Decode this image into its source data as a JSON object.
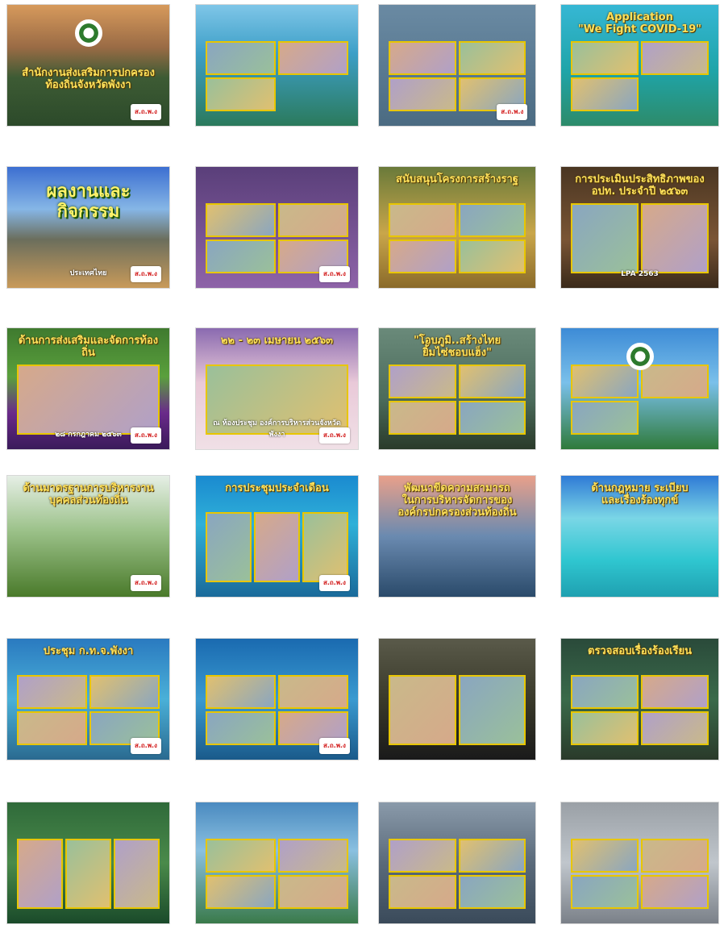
{
  "tiles": [
    {
      "caption": "สำนักงานส่งเสริมการปกครองท้องถิ่นจังหวัดพังงา",
      "sub": "",
      "bg": "linear-gradient(180deg,#d79a5c 0%,#9a6b45 35%,#3d5b34 60%,#2c4a2a 100%)",
      "style": "",
      "photos": 0,
      "cols": 1,
      "logo": "ส.ถ.พ.ง",
      "seal": true
    },
    {
      "caption": "",
      "sub": "",
      "bg": "linear-gradient(180deg,#7fc6e8 0%,#3d9fc7 40%,#2b7a5c 100%)",
      "style": "",
      "photos": 3,
      "cols": 2,
      "logo": "",
      "seal": false
    },
    {
      "caption": "",
      "sub": "",
      "bg": "linear-gradient(180deg,#6a8aa3 0%,#4b6b82 100%)",
      "style": "",
      "photos": 4,
      "cols": 2,
      "logo": "ส.ถ.พ.ง",
      "seal": false
    },
    {
      "caption": "Application\n\"We Fight COVID-19\"",
      "sub": "",
      "bg": "linear-gradient(180deg,#36b7d4 0%,#1fa4a8 55%,#2d8b6a 100%)",
      "style": "",
      "photos": 3,
      "cols": 2,
      "logo": "",
      "seal": false
    },
    {
      "caption": "ผลงานและกิจกรรม",
      "sub": "ประเทศไทย",
      "bg": "linear-gradient(180deg,#3c6fd1 0%,#86b6e6 35%,#6b6e5c 60%,#c89a5a 100%)",
      "style": "big",
      "photos": 0,
      "cols": 1,
      "logo": "ส.ถ.พ.ง",
      "seal": false
    },
    {
      "caption": "",
      "sub": "",
      "bg": "linear-gradient(180deg,#5a3f7a 0%,#8e63a8 100%)",
      "style": "",
      "photos": 4,
      "cols": 2,
      "logo": "ส.ถ.พ.ง",
      "seal": false
    },
    {
      "caption": "สนับสนุนโครงการสร้างราฐ",
      "sub": "",
      "bg": "linear-gradient(180deg,#6a7a3a 0%,#c9a64a 55%,#8a6a2a 100%)",
      "style": "",
      "photos": 4,
      "cols": 2,
      "logo": "",
      "seal": false
    },
    {
      "caption": "การประเมินประสิทธิภาพของ อปท. ประจำปี ๒๕๖๓",
      "sub": "LPA 2563",
      "bg": "linear-gradient(180deg,#4a3622 0%,#7a5535 60%,#3a2a1a 100%)",
      "style": "",
      "photos": 2,
      "cols": 2,
      "logo": "",
      "seal": false
    },
    {
      "caption": "ด้านการส่งเสริมและจัดการท้องถิ่น",
      "sub": "๒๘ กรกฎาคม ๒๕๖๓",
      "bg": "linear-gradient(180deg,#3f7a2f 0%,#5aa03c 40%,#6a2a8a 70%,#3a1a5a 100%)",
      "style": "",
      "photos": 1,
      "cols": 1,
      "logo": "ส.ถ.พ.ง",
      "seal": false
    },
    {
      "caption": "๒๒ - ๒๓ เมษายน ๒๕๖๓",
      "sub": "ณ ห้องประชุม องค์การบริหารส่วนจังหวัดพังงา",
      "bg": "linear-gradient(180deg,#8a6ab0 0%,#e9c9d8 45%,#f0e0e6 100%)",
      "style": "",
      "photos": 1,
      "cols": 1,
      "logo": "ส.ถ.พ.ง",
      "seal": false
    },
    {
      "caption": "\"โอบภูมิ..สร้างไทย\nยิ้มไซ่ชอบแฮ็ง\"",
      "sub": "",
      "bg": "linear-gradient(180deg,#6a8a7a 0%,#4a6a5a 60%,#2a3a2a 100%)",
      "style": "",
      "photos": 4,
      "cols": 2,
      "logo": "",
      "seal": false
    },
    {
      "caption": "",
      "sub": "",
      "bg": "linear-gradient(180deg,#3d8bd6 0%,#7ac0ea 45%,#2f7a3a 100%)",
      "style": "",
      "photos": 3,
      "cols": 2,
      "logo": "",
      "seal": true
    },
    {
      "caption": "ด้านมาตรฐานการบริหารงานบุคคลส่วนท้องถิ่น",
      "sub": "",
      "bg": "linear-gradient(180deg,#e6efe6 0%,#9cc28a 45%,#4a7a2a 100%)",
      "style": "",
      "photos": 0,
      "cols": 1,
      "logo": "ส.ถ.พ.ง",
      "seal": false
    },
    {
      "caption": "การประชุมประจำเดือน",
      "sub": "",
      "bg": "linear-gradient(180deg,#1a8ad0 0%,#2fb0d8 40%,#1a6a9a 100%)",
      "style": "",
      "photos": 3,
      "cols": 3,
      "logo": "ส.ถ.พ.ง",
      "seal": false
    },
    {
      "caption": "พัฒนาขีดความสามารถ\nในการบริหารจัดการขององค์กรปกครองส่วนท้องถิ่น",
      "sub": "",
      "bg": "linear-gradient(180deg,#e9a08a 0%,#6a8ab0 50%,#2a4a6a 100%)",
      "style": "",
      "photos": 0,
      "cols": 1,
      "logo": "",
      "seal": false
    },
    {
      "caption": "ด้านกฎหมาย ระเบียบ\nและเรื่องร้องทุกข์",
      "sub": "",
      "bg": "linear-gradient(180deg,#2f7ad6 0%,#7ad6e6 35%,#2fc6d0 70%,#1fa0b0 100%)",
      "style": "",
      "photos": 0,
      "cols": 1,
      "logo": "",
      "seal": false
    },
    {
      "caption": "ประชุม ก.ท.จ.พังงา",
      "sub": "",
      "bg": "linear-gradient(180deg,#2a7ac0 0%,#4ab0d8 50%,#2a6a90 100%)",
      "style": "",
      "photos": 4,
      "cols": 2,
      "logo": "ส.ถ.พ.ง",
      "seal": false
    },
    {
      "caption": "",
      "sub": "",
      "bg": "linear-gradient(180deg,#1a6ab0 0%,#3a9ad0 50%,#1a5a8a 100%)",
      "style": "",
      "photos": 4,
      "cols": 2,
      "logo": "ส.ถ.พ.ง",
      "seal": false
    },
    {
      "caption": "",
      "sub": "",
      "bg": "linear-gradient(180deg,#5a5a4a 0%,#3a3a2a 50%,#1a1a1a 100%)",
      "style": "",
      "photos": 2,
      "cols": 2,
      "logo": "",
      "seal": false
    },
    {
      "caption": "ตรวจสอบเรื่องร้องเรียน",
      "sub": "",
      "bg": "linear-gradient(180deg,#2a4a3a 0%,#3a6a4a 50%,#2a3a2a 100%)",
      "style": "",
      "photos": 4,
      "cols": 2,
      "logo": "",
      "seal": false
    },
    {
      "caption": "",
      "sub": "",
      "bg": "linear-gradient(180deg,#2f6a3a 0%,#4a8a4a 50%,#1a4a2a 100%)",
      "style": "",
      "photos": 3,
      "cols": 3,
      "logo": "",
      "seal": false
    },
    {
      "caption": "",
      "sub": "",
      "bg": "linear-gradient(180deg,#4a8ac0 0%,#8ac0e0 40%,#3a7a4a 100%)",
      "style": "",
      "photos": 4,
      "cols": 2,
      "logo": "",
      "seal": false
    },
    {
      "caption": "",
      "sub": "",
      "bg": "linear-gradient(180deg,#8a9aaa 0%,#5a6a7a 50%,#3a4a5a 100%)",
      "style": "",
      "photos": 4,
      "cols": 2,
      "logo": "",
      "seal": false
    },
    {
      "caption": "",
      "sub": "",
      "bg": "linear-gradient(180deg,#9aa0a6 0%,#c0c6cc 50%,#7a8088 100%)",
      "style": "",
      "photos": 4,
      "cols": 2,
      "logo": "",
      "seal": false
    }
  ]
}
